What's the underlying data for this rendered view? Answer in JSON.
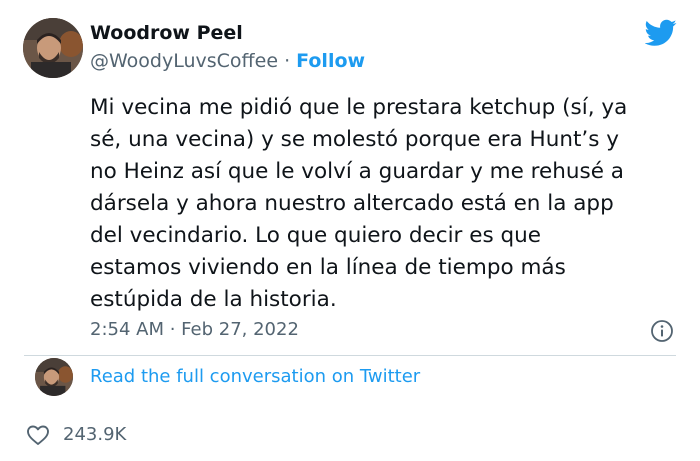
{
  "author": {
    "display_name": "Woodrow Peel",
    "handle": "@WoodyLuvsCoffee",
    "separator": "·",
    "follow_label": "Follow"
  },
  "tweet": {
    "lines": [
      "Mi vecina me pidió que le prestara ketchup (sí, ya",
      "sé, una vecina) y se molestó porque era Hunt’s y",
      "no Heinz así que le volví a guardar y me rehusé a",
      "dársela y ahora nuestro altercado está en la app",
      "del vecindario. Lo que quiero decir es que",
      "estamos viviendo en la línea de tiempo más",
      "estúpida de la historia."
    ],
    "timestamp": "2:54 AM · Feb 27, 2022"
  },
  "conversation": {
    "link_label": "Read the full conversation on Twitter"
  },
  "engagement": {
    "likes": "243.9K"
  },
  "icons": {
    "brand": "twitter-bird-icon",
    "info": "info-icon",
    "like": "heart-icon"
  },
  "colors": {
    "brand_blue": "#1d9bf0",
    "secondary_text": "#536471",
    "primary_text": "#0f1419",
    "divider": "#cfd9de"
  }
}
